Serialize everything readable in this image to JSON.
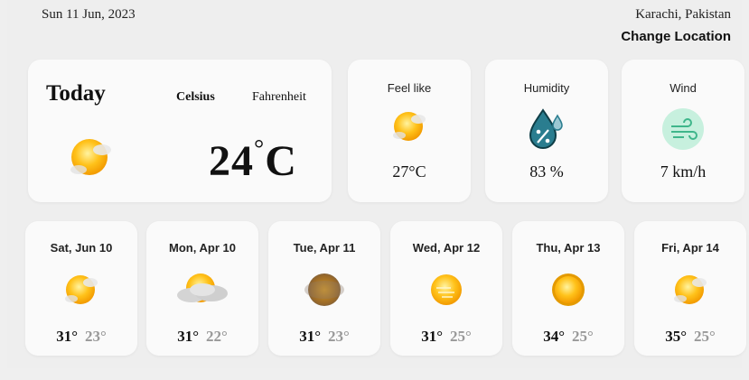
{
  "header": {
    "date": "Sun 11 Jun, 2023",
    "location": "Karachi, Pakistan",
    "change_location": "Change Location"
  },
  "today": {
    "title": "Today",
    "unit_celsius": "Celsius",
    "unit_fahrenheit": "Fahrenheit",
    "temp_value": "24",
    "temp_unit": "C",
    "icon": "sun-cloud-icon"
  },
  "feel": {
    "label": "Feel like",
    "value": "27°C",
    "icon": "sun-cloud-icon"
  },
  "humidity": {
    "label": "Humidity",
    "value": "83 %",
    "icon": "humidity-drop-icon"
  },
  "wind": {
    "label": "Wind",
    "value": "7 km/h",
    "icon": "wind-icon"
  },
  "forecast": [
    {
      "day": "Sat, Jun 10",
      "hi": "31°",
      "lo": "23°",
      "icon": "sun-cloud-icon"
    },
    {
      "day": "Mon, Apr 10",
      "hi": "31°",
      "lo": "22°",
      "icon": "cloudy-sun-icon"
    },
    {
      "day": "Tue, Apr 11",
      "hi": "31°",
      "lo": "23°",
      "icon": "hazy-sun-icon"
    },
    {
      "day": "Wed, Apr 12",
      "hi": "31°",
      "lo": "25°",
      "icon": "sun-wind-icon"
    },
    {
      "day": "Thu, Apr 13",
      "hi": "34°",
      "lo": "25°",
      "icon": "sun-icon"
    },
    {
      "day": "Fri, Apr 14",
      "hi": "35°",
      "lo": "25°",
      "icon": "sun-cloud-icon"
    }
  ],
  "colors": {
    "sun": "#f7b500",
    "humidity": "#2a7d8f",
    "wind": "#3fb68b"
  }
}
